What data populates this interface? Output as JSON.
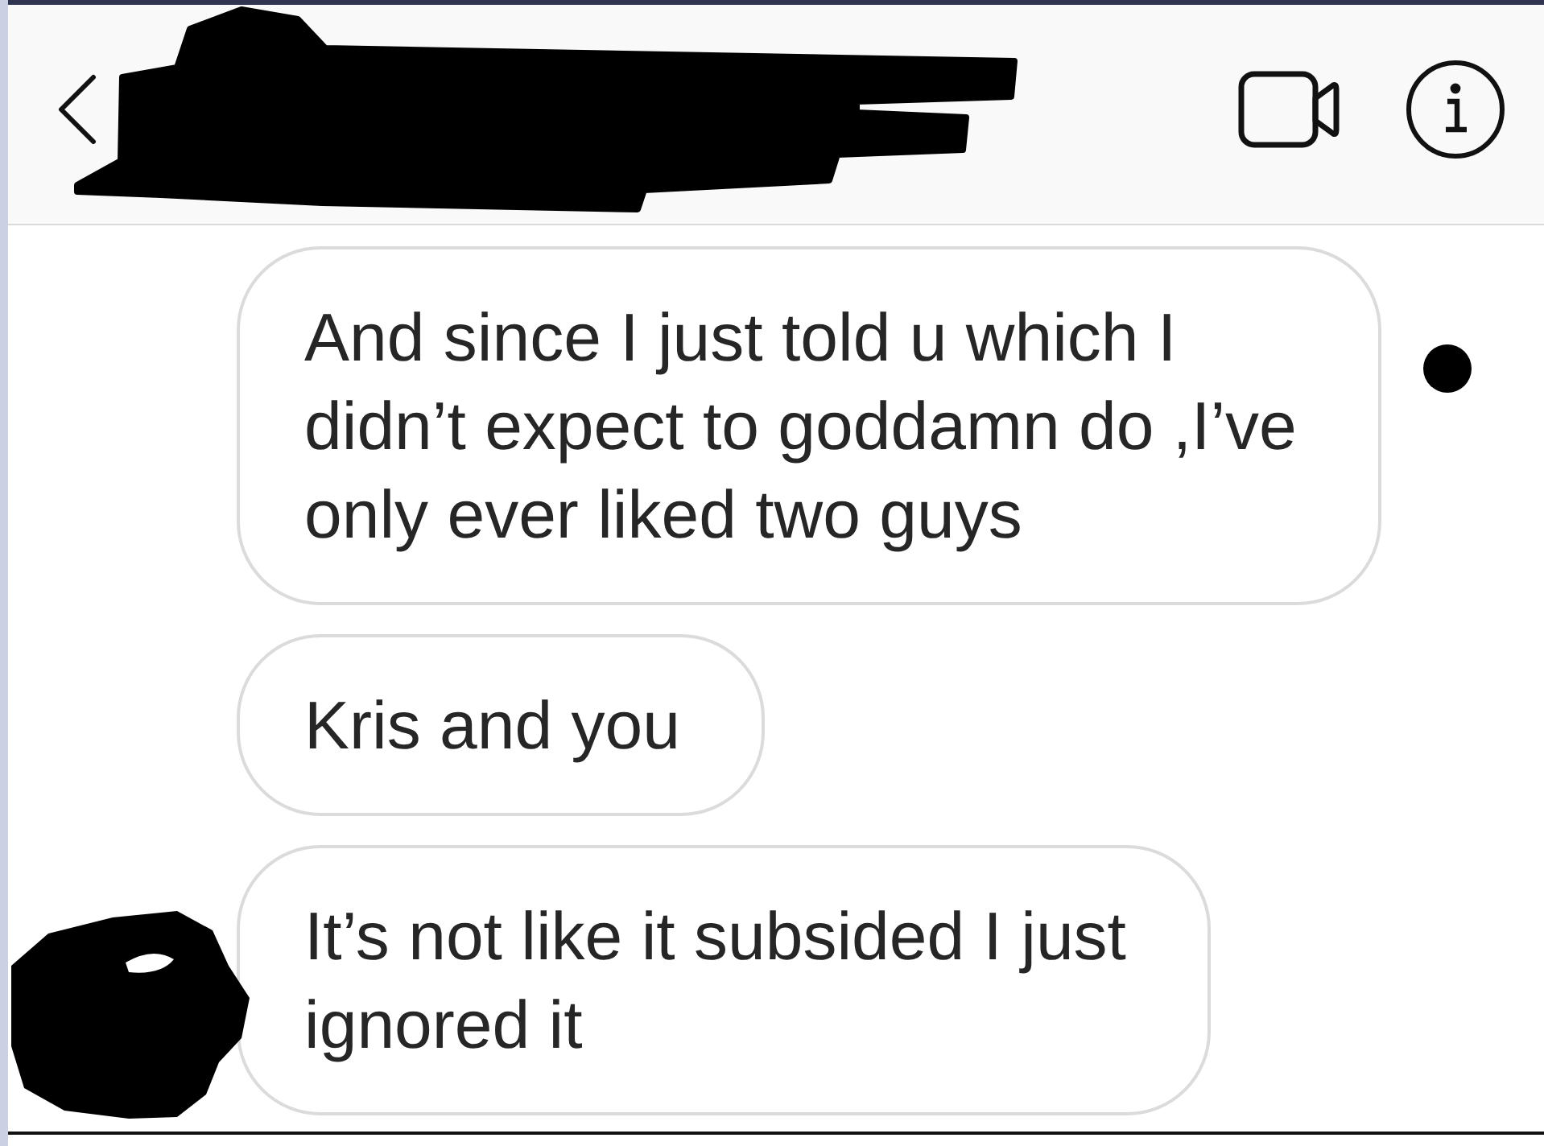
{
  "messages": [
    {
      "text": "And since I just told u which I didn’t expect to goddamn do ,I’ve only ever liked two guys",
      "marker": true
    },
    {
      "text": "Kris and you",
      "marker": false
    },
    {
      "text": "It’s not like it subsided I just ignored it",
      "marker": false
    }
  ]
}
